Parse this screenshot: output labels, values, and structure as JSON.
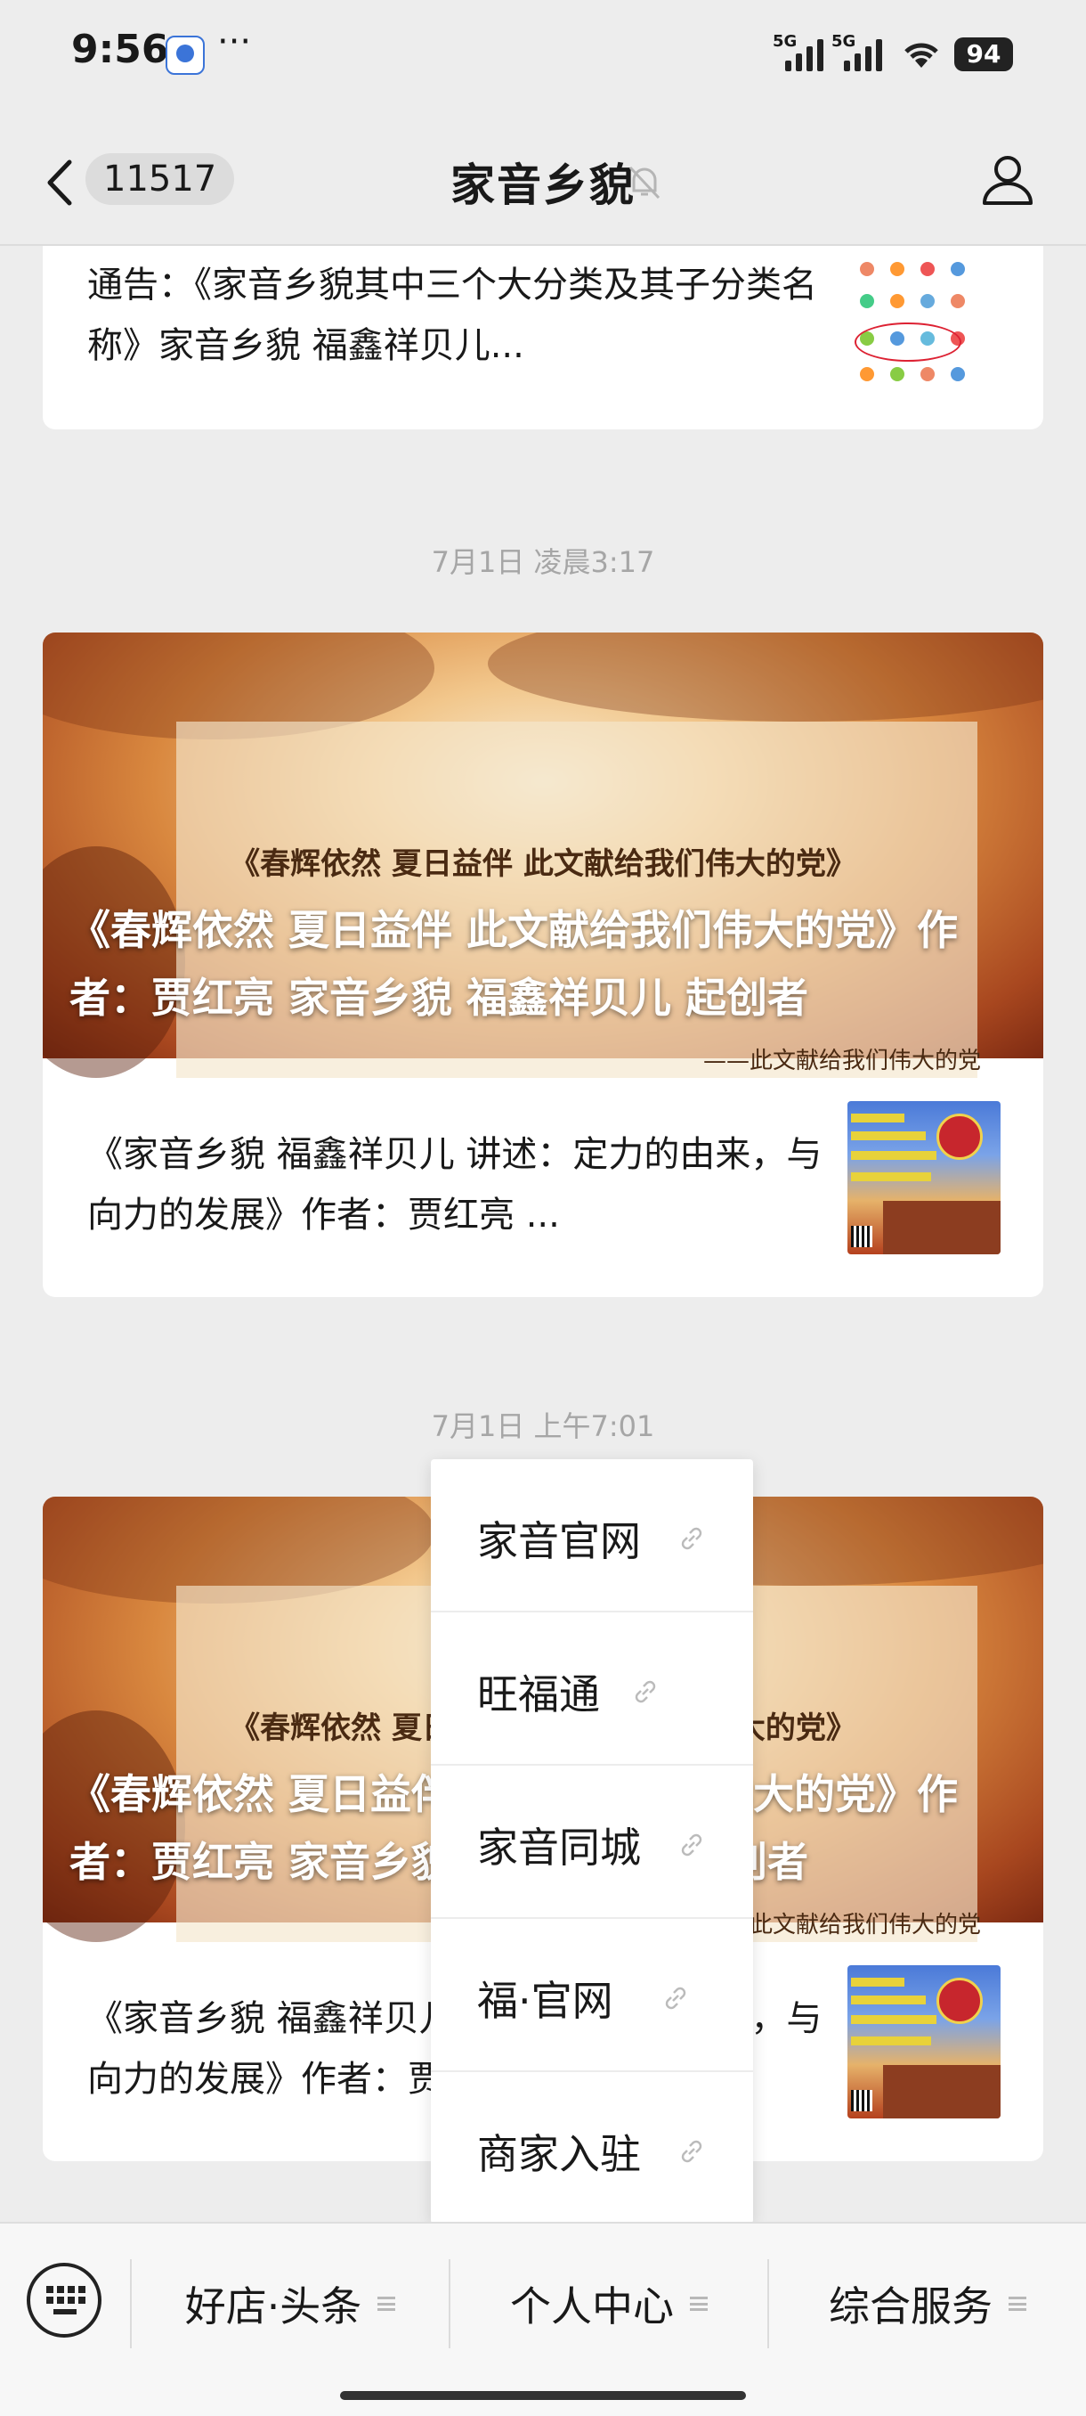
{
  "status_bar": {
    "time": "9:56",
    "dots": "···",
    "sig1": "5G",
    "sig2": "5G",
    "battery": "94"
  },
  "nav": {
    "unread_count": "11517",
    "title": "家音乡貌"
  },
  "messages": {
    "top_row": {
      "text": "通告：《家音乡貌其中三个大分类及其子分类名称》家音乡貌 福鑫祥贝儿..."
    },
    "group1": {
      "date": "7月1日 凌晨3:17",
      "hero_poem": "《春辉依然 夏日益伴 此文献给我们伟大的党》",
      "hero_caption": "《春辉依然 夏日益伴 此文献给我们伟大的党》作者：贾红亮 家音乡貌 福鑫祥贝儿 起创者",
      "hero_credit": "——此文献给我们伟大的党",
      "sub_text": "《家音乡貌 福鑫祥贝儿 讲述：定力的由来，与向力的发展》作者：贾红亮 ..."
    },
    "group2": {
      "date": "7月1日 上午7:01",
      "hero_poem": "《春辉依然 夏日益伴 此文献给我们伟大的党》",
      "hero_caption": "《春辉依然 夏日益伴 此文献给我们伟大的党》作者：贾红亮 家音乡貌 福鑫祥贝儿 起创者",
      "hero_credit": "——此文献给我们伟大的党",
      "sub_text": "《家音乡貌 福鑫祥贝儿 讲述：定力的由来，与向力的发展》作者：贾红亮 ..."
    }
  },
  "popup_menu": {
    "items": [
      {
        "label": "家音官网"
      },
      {
        "label": "旺福通"
      },
      {
        "label": "家音同城"
      },
      {
        "label": "福·官网"
      },
      {
        "label": "商家入驻"
      }
    ]
  },
  "bottom_menu": {
    "tabs": [
      {
        "label": "好店·头条"
      },
      {
        "label": "个人中心"
      },
      {
        "label": "综合服务"
      }
    ]
  }
}
